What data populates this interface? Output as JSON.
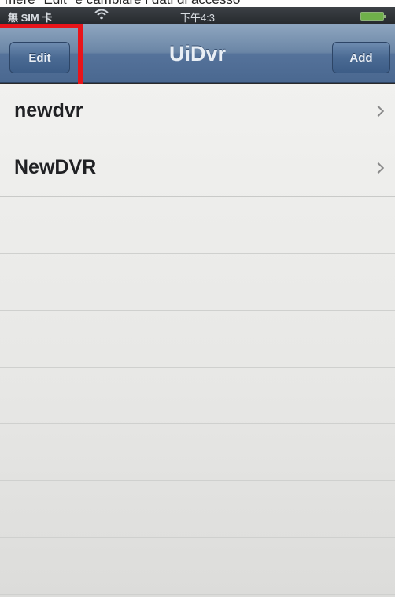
{
  "caption": {
    "text": "mere \"Edit\" e cambiare i dati di accesso"
  },
  "status_bar": {
    "carrier": "無 SIM 卡",
    "wifi_icon": "wifi-icon",
    "time": "下午4:3",
    "battery_icon": "battery-icon"
  },
  "nav_bar": {
    "title": "UiDvr",
    "edit_label": "Edit",
    "add_label": "Add"
  },
  "list": {
    "items": [
      {
        "label": "newdvr",
        "icon": "chevron-right-icon"
      },
      {
        "label": "NewDVR",
        "icon": "chevron-right-icon"
      }
    ]
  },
  "colors": {
    "nav_bar": "#5e7aa0",
    "highlight": "#e8141a",
    "table_background": "#ececea"
  }
}
